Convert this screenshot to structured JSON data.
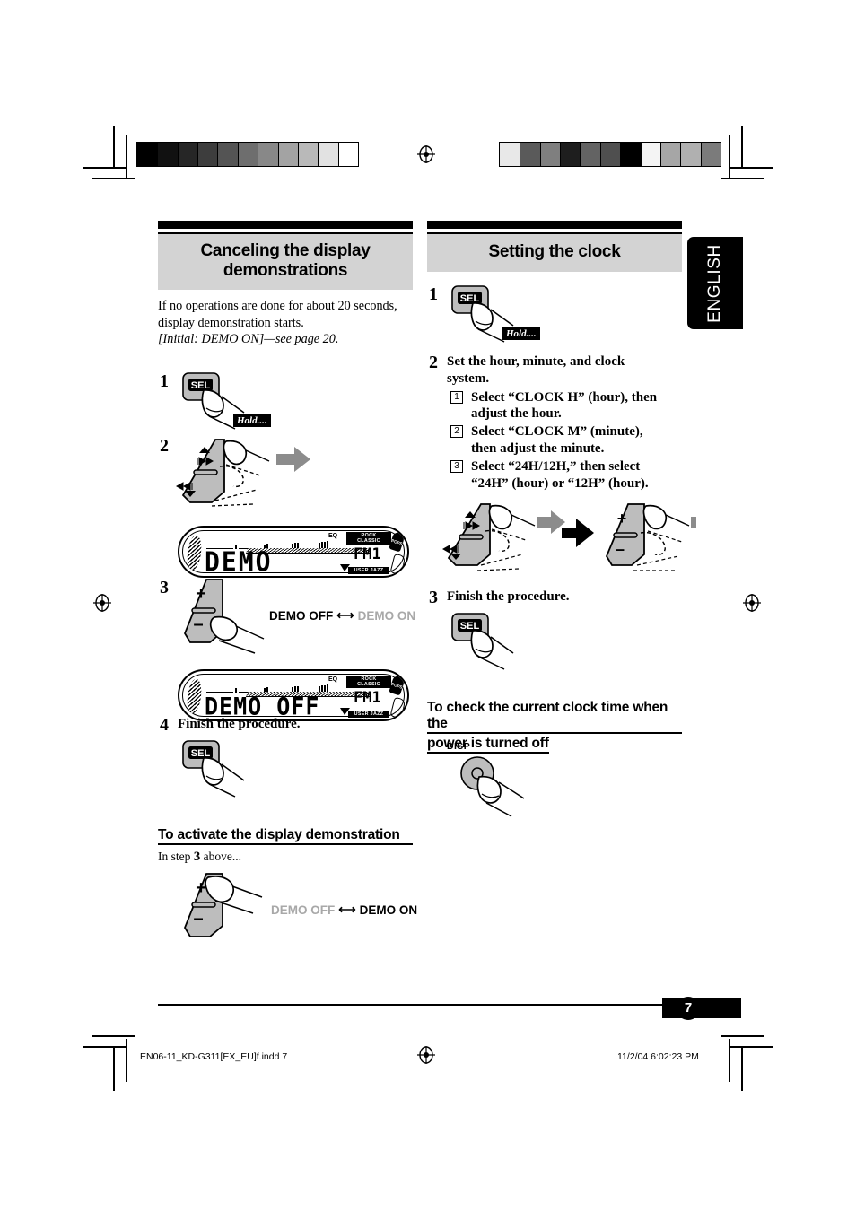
{
  "page": {
    "number": "7",
    "language_tab": "ENGLISH"
  },
  "left_column": {
    "section_title": "Canceling the display\ndemonstrations",
    "section_title_line1": "Canceling the display",
    "section_title_line2": "demonstrations",
    "intro_line1": "If no operations are done for about 20 seconds,",
    "intro_line2": "display demonstration starts.",
    "intro_line3": "[Initial: DEMO ON]—see page 20.",
    "steps": [
      {
        "num": "1",
        "title": "",
        "button": "SEL",
        "hold_label": "Hold...."
      },
      {
        "num": "2",
        "title": ""
      },
      {
        "num": "3",
        "title": ""
      },
      {
        "num": "4",
        "title": "Finish the procedure.",
        "button": "SEL"
      }
    ],
    "display_1": {
      "text": "DEMO",
      "band": "FM1",
      "tag_top": "ROCK  CLASSIC",
      "tag_bottom": "USER  JAZZ",
      "tag_side": "POPS",
      "eq_label": "EQ"
    },
    "display_2": {
      "text": "DEMO OFF",
      "band": "FM1",
      "tag_top": "ROCK  CLASSIC",
      "tag_bottom": "USER  JAZZ",
      "tag_side": "POPS",
      "eq_label": "EQ"
    },
    "toggle_1": {
      "left": "DEMO OFF",
      "right": "DEMO ON",
      "left_active": true,
      "right_active": false
    },
    "subsection": {
      "heading": "To activate the display demonstration",
      "note_pre": "In step ",
      "note_num": "3",
      "note_post": " above..."
    },
    "toggle_2": {
      "left": "DEMO OFF",
      "right": "DEMO ON",
      "left_active": false,
      "right_active": true
    },
    "plusminus": {
      "plus": "+",
      "minus": "–"
    }
  },
  "right_column": {
    "section_title": "Setting the clock",
    "steps": [
      {
        "num": "1",
        "title": "",
        "button": "SEL",
        "hold_label": "Hold...."
      },
      {
        "num": "2",
        "title_line1": "Set the hour, minute, and clock",
        "title_line2": "system.",
        "substeps": [
          {
            "num": "1",
            "line1": "Select “CLOCK H” (hour), then",
            "line2": "adjust the hour."
          },
          {
            "num": "2",
            "line1": "Select “CLOCK M” (minute),",
            "line2": "then adjust the minute."
          },
          {
            "num": "3",
            "line1": "Select “24H/12H,” then select",
            "line2": "“24H” (hour) or “12H” (hour)."
          }
        ]
      },
      {
        "num": "3",
        "title": "Finish the procedure.",
        "button": "SEL"
      }
    ],
    "subsection": {
      "heading_line1": "To check the current clock time when the",
      "heading_line2": "power is turned off",
      "button_label": "DISP"
    }
  },
  "footer": {
    "file_name": "EN06-11_KD-G311[EX_EU]f.indd   7",
    "timestamp": "11/2/04   6:02:23 PM"
  },
  "calibration": {
    "left_bar": [
      "#000000",
      "#111111",
      "#262626",
      "#3d3d3d",
      "#545454",
      "#6e6e6e",
      "#888888",
      "#a3a3a3",
      "#b9b9b9",
      "#e2e2e2",
      "#ffffff"
    ],
    "right_bar": [
      "#e8e8e8",
      "#5a5a5a",
      "#7f7f7f",
      "#1e1e1e",
      "#636363",
      "#4f4f4f",
      "#000000",
      "#f4f4f4",
      "#a6a6a6",
      "#b0b0b0",
      "#7b7b7b"
    ]
  },
  "colors": {
    "band_bg": "#d3d3d3",
    "ink": "#000000",
    "dim_text": "#a8a8a8",
    "button_face": "#b5b5b5",
    "finger_fill": "#ffffff"
  }
}
